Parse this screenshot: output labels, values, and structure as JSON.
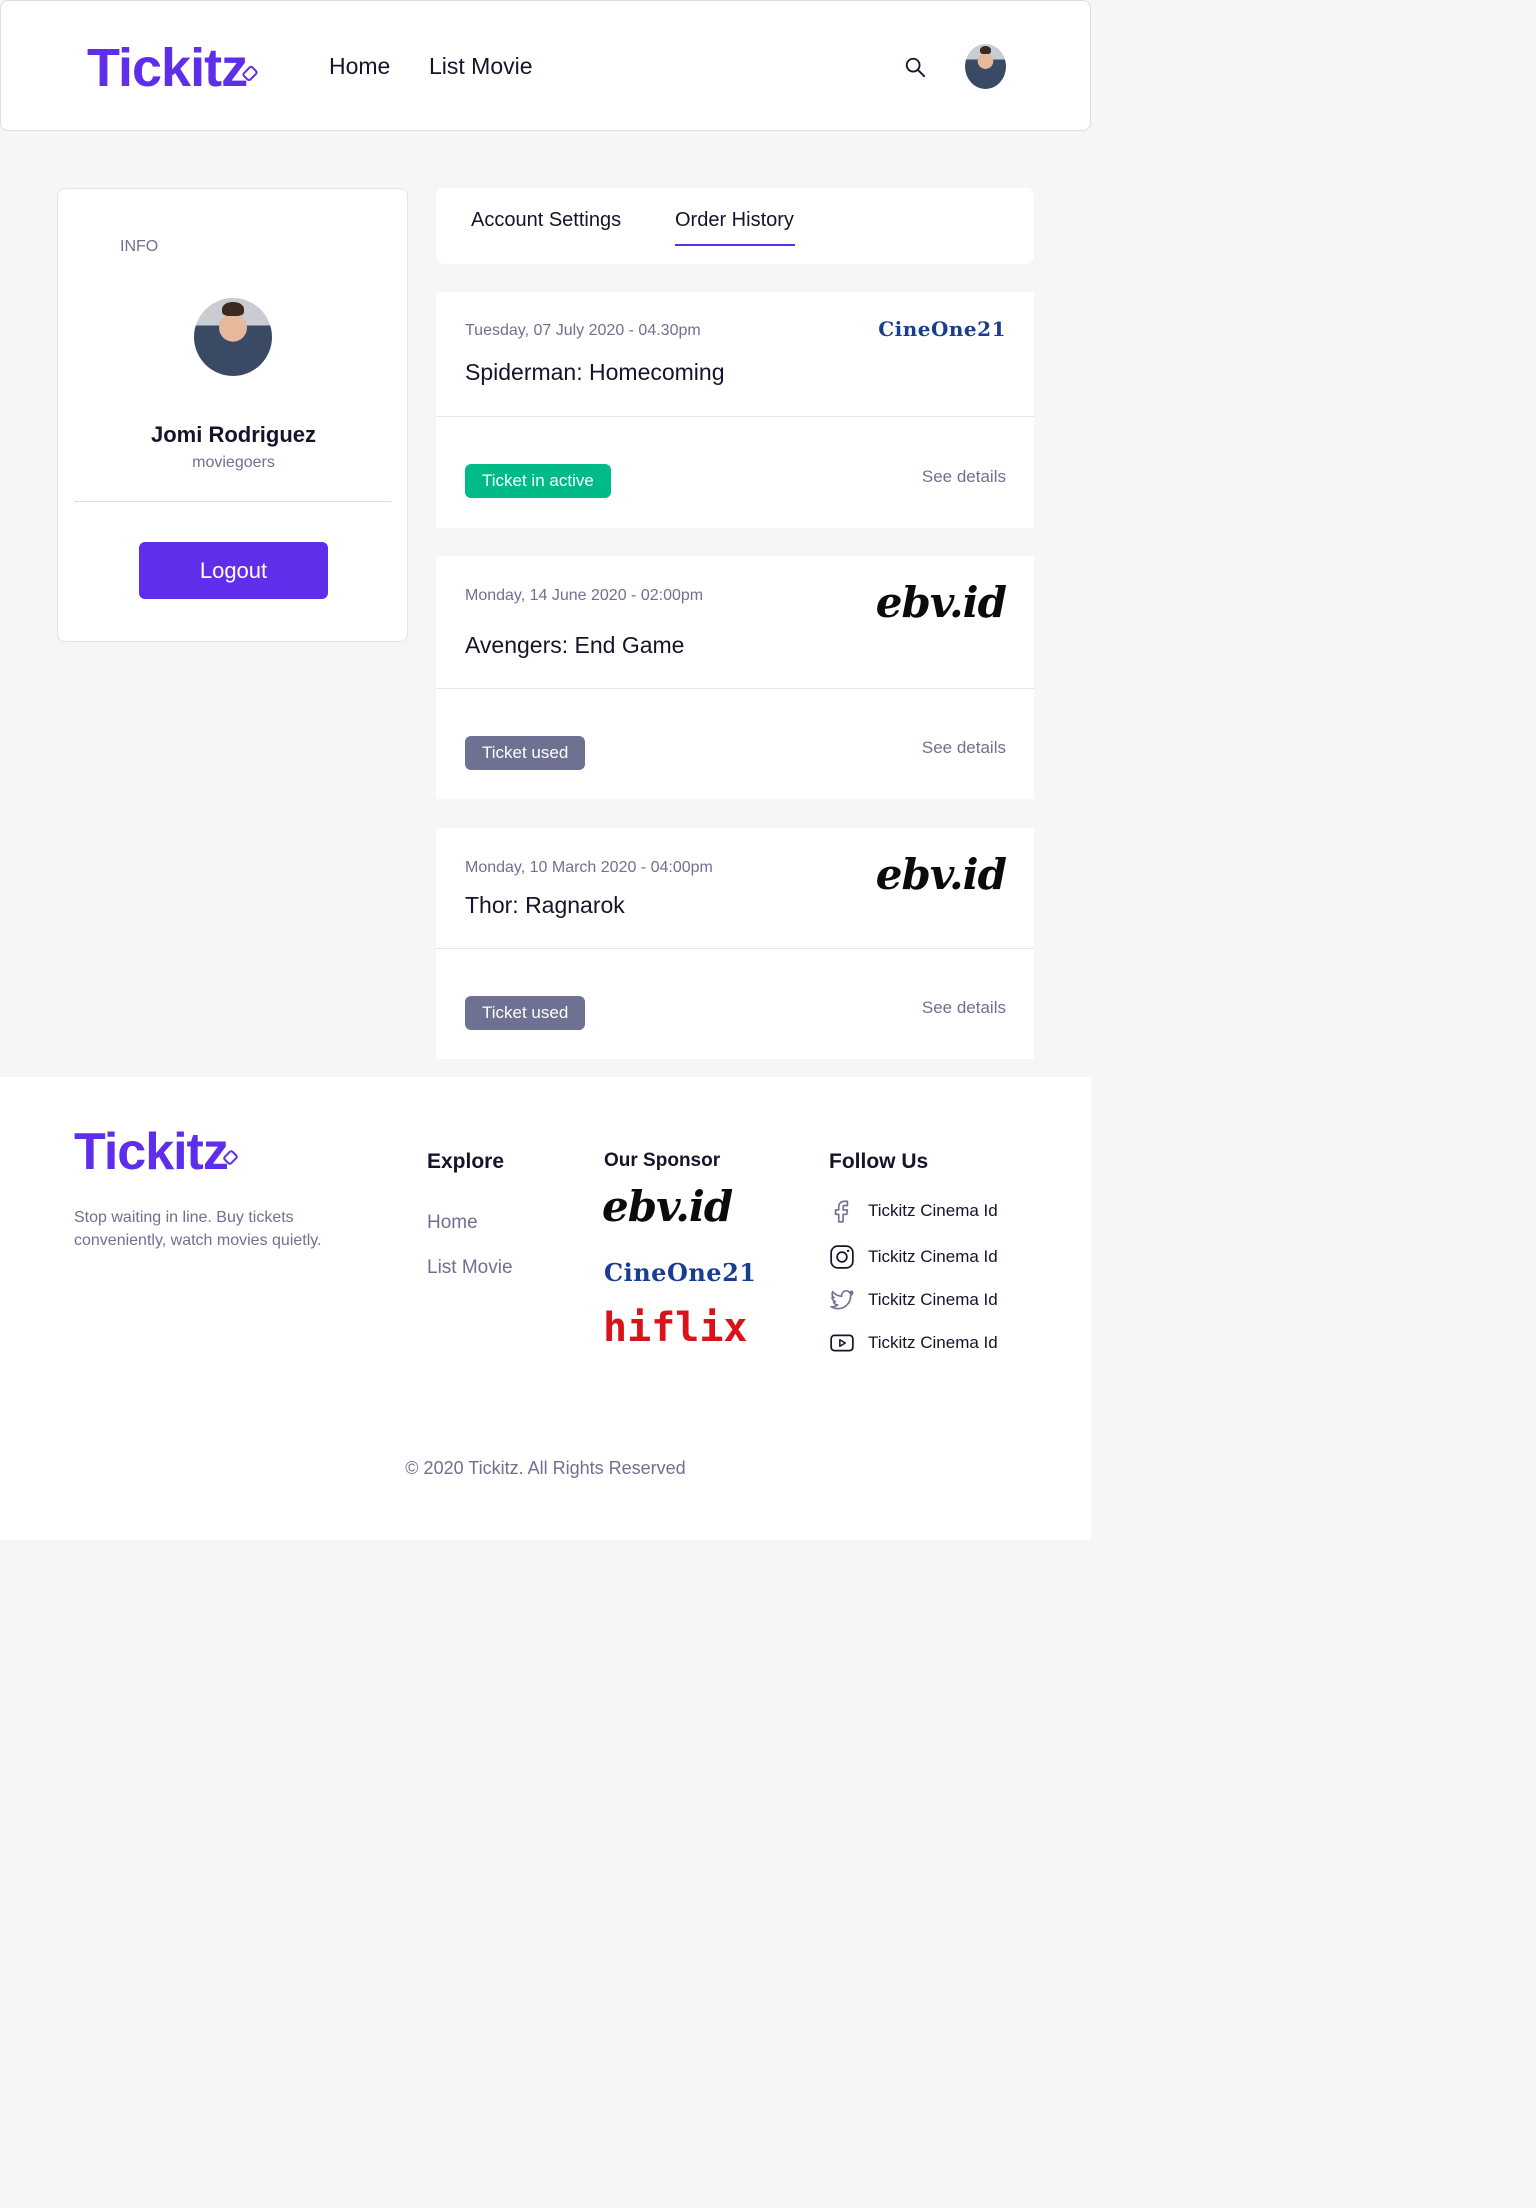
{
  "header": {
    "brand": "Tickitz",
    "nav": [
      "Home",
      "List Movie"
    ]
  },
  "profile": {
    "info_label": "INFO",
    "name": "Jomi Rodriguez",
    "role": "moviegoers",
    "logout_label": "Logout"
  },
  "tabs": [
    "Account Settings",
    "Order History"
  ],
  "orders": [
    {
      "date": "Tuesday, 07 July 2020 - 04.30pm",
      "title": "Spiderman: Homecoming",
      "status": "Ticket in active",
      "status_color": "#00ba88",
      "sponsor": "CineOne21",
      "details_label": "See details"
    },
    {
      "date": "Monday, 14 June 2020 - 02:00pm",
      "title": "Avengers: End Game",
      "status": "Ticket used",
      "status_color": "#6e7191",
      "sponsor": "ebv.id",
      "details_label": "See details"
    },
    {
      "date": "Monday, 10 March 2020 - 04:00pm",
      "title": "Thor: Ragnarok",
      "status": "Ticket used",
      "status_color": "#6e7191",
      "sponsor": "ebv.id",
      "details_label": "See details"
    }
  ],
  "footer": {
    "brand": "Tickitz",
    "tagline": "Stop waiting in line. Buy tickets conveniently, watch movies quietly.",
    "explore_heading": "Explore",
    "explore_links": [
      "Home",
      "List Movie"
    ],
    "sponsor_heading": "Our Sponsor",
    "sponsors": [
      "ebv.id",
      "CineOne21",
      "hiflix"
    ],
    "follow_heading": "Follow Us",
    "socials": [
      {
        "icon": "facebook-icon",
        "label": "Tickitz Cinema Id"
      },
      {
        "icon": "instagram-icon",
        "label": "Tickitz Cinema Id"
      },
      {
        "icon": "twitter-icon",
        "label": "Tickitz Cinema Id"
      },
      {
        "icon": "youtube-icon",
        "label": "Tickitz Cinema Id"
      }
    ],
    "copyright": "© 2020 Tickitz. All Rights Reserved"
  },
  "colors": {
    "brand": "#5f2eea",
    "active": "#00ba88",
    "used": "#6e7191"
  }
}
